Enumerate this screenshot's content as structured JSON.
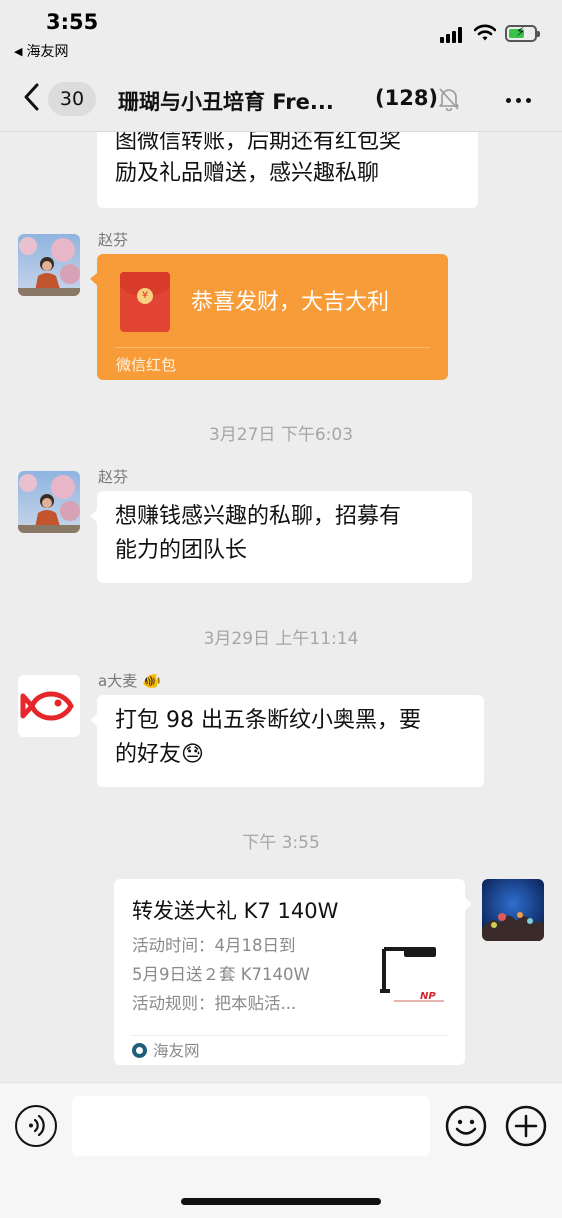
{
  "status": {
    "time": "3:55",
    "back_app": "海友网",
    "battery_color": "#38c24a"
  },
  "nav": {
    "unread_count": "30",
    "title": "珊瑚与小丑培育 Fre...",
    "member_count": "(128)",
    "icons": [
      "back-chevron-icon",
      "mute-bell-icon",
      "more-icon"
    ]
  },
  "messages": {
    "m0": {
      "line1": "图微信转账，后期还有红包奖",
      "line2": "励及礼品赠送，感兴趣私聊"
    },
    "m1": {
      "sender": "赵芬",
      "red_packet_text": "恭喜发财，大吉大利",
      "red_packet_label": "微信红包",
      "bubble_color": "#f79c39"
    },
    "ts1": "3月27日 下午6:03",
    "m2": {
      "sender": "赵芬",
      "line1": "想赚钱感兴趣的私聊，招募有",
      "line2": "能力的团队长"
    },
    "ts2": "3月29日 上午11:14",
    "m3": {
      "sender": "a大麦",
      "sender_emoji": "🐠",
      "line1": "打包 98 出五条断纹小奥黑，要",
      "line2": "的好友",
      "line2_emoji": "😓"
    },
    "ts3": "下午 3:55",
    "m4": {
      "card_title": "转发送大礼 K7 140W",
      "desc1": "活动时间：4月18日到",
      "desc2": "5月9日送２套 K7140W",
      "desc3": "活动规则：把本贴活...",
      "source": "海友网"
    }
  },
  "input": {
    "placeholder": "",
    "icons": [
      "voice-icon",
      "emoji-icon",
      "plus-icon"
    ]
  }
}
